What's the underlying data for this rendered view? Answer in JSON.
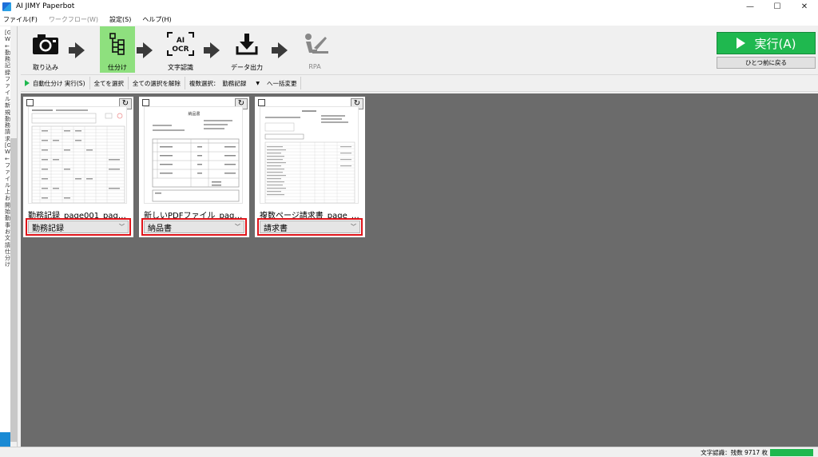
{
  "window": {
    "title": "AI JIMY Paperbot",
    "controls": [
      "—",
      "☐",
      "✕"
    ]
  },
  "menu": [
    {
      "label": "ファイル(F)",
      "enabled": true
    },
    {
      "label": "ワークフロー(W)",
      "enabled": false
    },
    {
      "label": "設定(S)",
      "enabled": true
    },
    {
      "label": "ヘルプ(H)",
      "enabled": true
    }
  ],
  "left_panel": {
    "text": "[G W ←勤務記録 ファイル 新規 勤務 請求 [G W ←ファイル 上 お 開 始 勤 事 お 文 請 仕分 け"
  },
  "workflow": {
    "steps": [
      {
        "label": "取り込み",
        "icon": "camera-icon",
        "active": false,
        "enabled": true
      },
      {
        "label": "仕分け",
        "icon": "sort-tree-icon",
        "active": true,
        "enabled": true
      },
      {
        "label": "文字認識",
        "icon": "ai-ocr-icon",
        "icon_text_1": "AI",
        "icon_text_2": "OCR",
        "active": false,
        "enabled": true
      },
      {
        "label": "データ出力",
        "icon": "download-icon",
        "active": false,
        "enabled": true
      },
      {
        "label": "RPA",
        "icon": "rpa-robot-icon",
        "active": false,
        "enabled": false
      }
    ],
    "run_label": "実行(A)",
    "back_label": "ひとつ前に戻る"
  },
  "actions": {
    "auto_sort": "自動仕分け 実行(S)",
    "select_all": "全てを選択",
    "deselect_all": "全ての選択を解除",
    "multi_select_label": "複数選択：",
    "multi_select_value": "勤務記録",
    "bulk_change": "へ一括変更"
  },
  "cards": [
    {
      "filename": "勤務記録_page001_page...",
      "category": "勤務記録",
      "thumb_title": ""
    },
    {
      "filename": "新しいPDFファイル_page_00...",
      "category": "納品書",
      "thumb_title": "納品書"
    },
    {
      "filename": "複数ページ請求書_page_0...",
      "category": "請求書",
      "thumb_title": ""
    }
  ],
  "status": {
    "text": "文字認識：残数 9717 枚"
  },
  "colors": {
    "accent_green": "#1fb84f",
    "active_step": "#8ee07e",
    "highlight_red": "#e0141a",
    "grid_bg": "#6b6b6b"
  }
}
